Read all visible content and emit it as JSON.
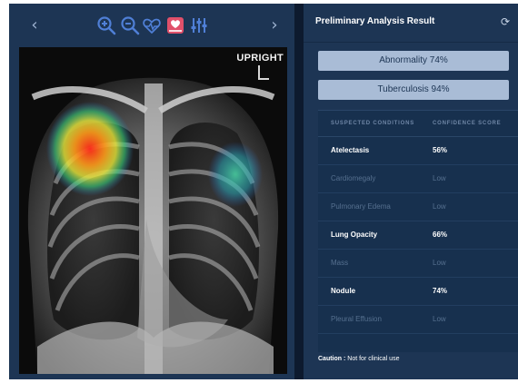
{
  "viewer": {
    "prev_icon": "chevron-left-icon",
    "next_icon": "chevron-right-icon",
    "prev_glyph": "‹",
    "next_glyph": "›",
    "tools": [
      "zoom-in-icon",
      "zoom-out-icon",
      "heart-icon",
      "heatmap-icon",
      "adjust-sliders-icon"
    ],
    "orientation_label": "UPRIGHT",
    "orientation_mark": "L"
  },
  "panel": {
    "title": "Preliminary Analysis Result",
    "refresh_icon": "refresh-icon",
    "refresh_glyph": "⟳",
    "results": [
      {
        "label": "Abnormality 74%"
      },
      {
        "label": "Tuberculosis 94%"
      }
    ],
    "table": {
      "col_condition": "SUSPECTED CONDITIONS",
      "col_score": "CONFIDENCE SCORE",
      "rows": [
        {
          "name": "Atelectasis",
          "score": "56%",
          "highlight": true
        },
        {
          "name": "Cardiomegaly",
          "score": "Low",
          "highlight": false
        },
        {
          "name": "Pulmonary Edema",
          "score": "Low",
          "highlight": false
        },
        {
          "name": "Lung Opacity",
          "score": "66%",
          "highlight": true
        },
        {
          "name": "Mass",
          "score": "Low",
          "highlight": false
        },
        {
          "name": "Nodule",
          "score": "74%",
          "highlight": true
        },
        {
          "name": "Pleural Effusion",
          "score": "Low",
          "highlight": false
        }
      ]
    },
    "caution_label": "Caution :",
    "caution_text": " Not for clinical use"
  },
  "colors": {
    "panel_bg": "#1d3554",
    "button_bg": "#a9bcd6",
    "tool_blue": "#4f7fd6",
    "tool_active": "#e0506a"
  }
}
